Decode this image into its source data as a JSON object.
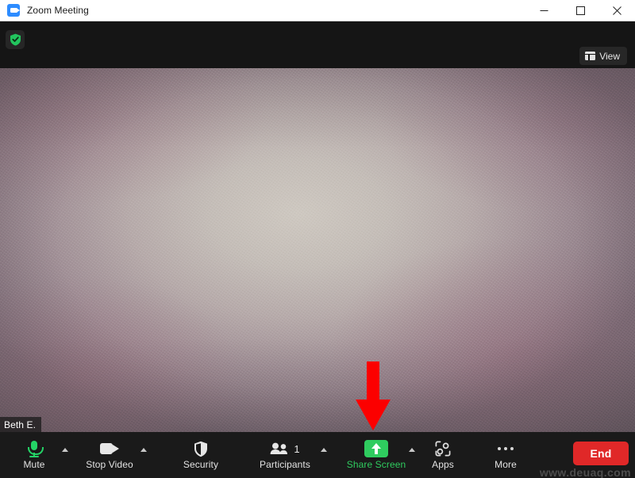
{
  "window": {
    "title": "Zoom Meeting",
    "app_icon": "zoom-camera-icon",
    "controls": {
      "minimize": "minimize-icon",
      "maximize": "maximize-icon",
      "close": "close-icon"
    }
  },
  "meeting_header": {
    "encryption_badge": "green-shield-check-icon",
    "view_button": {
      "label": "View",
      "icon": "layout-grid-icon"
    }
  },
  "video": {
    "participant_name": "Beth E.",
    "annotation": {
      "type": "red-down-arrow",
      "color": "#ff0000",
      "points_at": "Share Screen"
    }
  },
  "toolbar": {
    "items": [
      {
        "id": "mute",
        "label": "Mute",
        "icon": "microphone-icon",
        "icon_color": "#24d366",
        "has_caret": true
      },
      {
        "id": "stop-video",
        "label": "Stop Video",
        "icon": "video-camera-icon",
        "icon_color": "#e6e6e6",
        "has_caret": true
      },
      {
        "id": "security",
        "label": "Security",
        "icon": "shield-icon",
        "icon_color": "#e6e6e6",
        "has_caret": false
      },
      {
        "id": "participants",
        "label": "Participants",
        "icon": "people-icon",
        "icon_color": "#e6e6e6",
        "badge": "1",
        "has_caret": true
      },
      {
        "id": "share-screen",
        "label": "Share Screen",
        "icon": "share-up-arrow-icon",
        "icon_color": "#ffffff",
        "button_color": "#2fcc5f",
        "label_color": "#2fcc5f",
        "has_caret": true
      },
      {
        "id": "apps",
        "label": "Apps",
        "icon": "apps-icon",
        "icon_color": "#e6e6e6",
        "has_caret": false
      },
      {
        "id": "more",
        "label": "More",
        "icon": "ellipsis-icon",
        "icon_color": "#d8d8d8",
        "has_caret": false
      }
    ],
    "end_button": {
      "label": "End",
      "color": "#e02828"
    }
  },
  "watermark": {
    "text": "www.deuaq.com"
  }
}
